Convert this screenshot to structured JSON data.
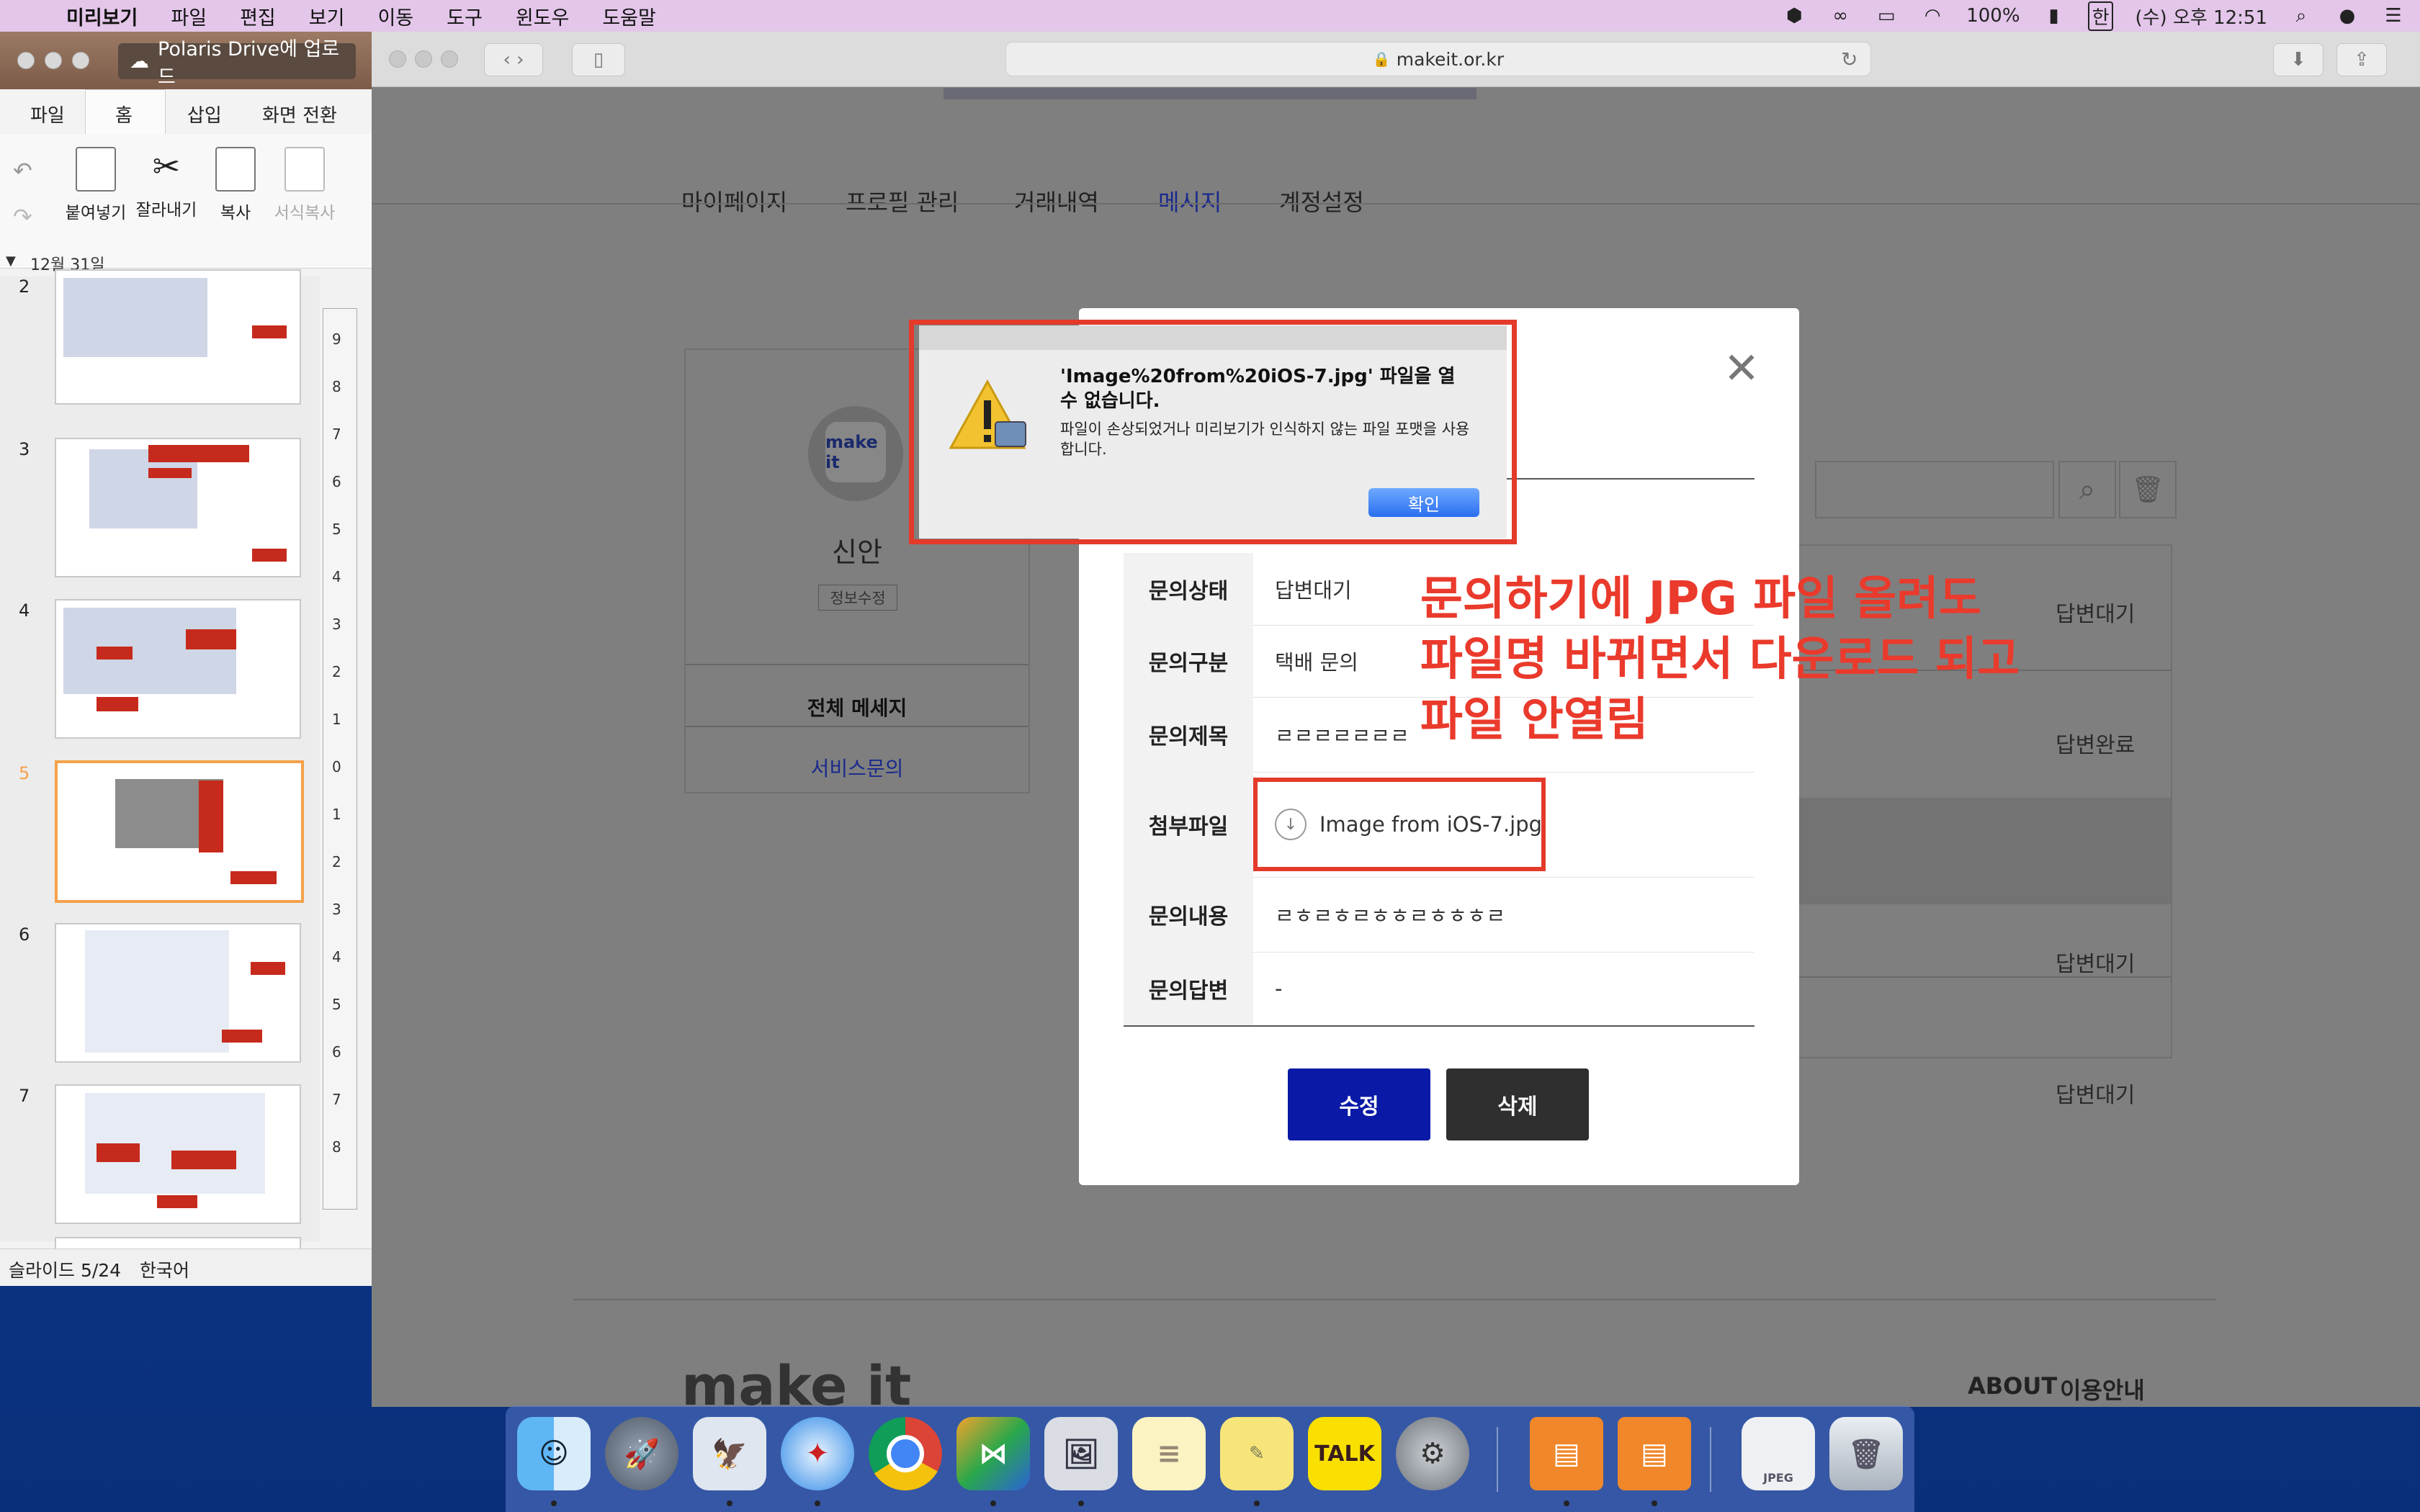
{
  "menubar": {
    "app_name": "미리보기",
    "items": [
      "파일",
      "편집",
      "보기",
      "이동",
      "도구",
      "윈도우",
      "도움말"
    ],
    "battery": "100%",
    "input_lang": "한",
    "clock": "(수) 오후 12:51"
  },
  "browser": {
    "url": "makeit.or.kr",
    "nav": [
      "마이페이지",
      "프로필 관리",
      "거래내역",
      "메시지",
      "계정설정"
    ],
    "active_nav": "메시지",
    "profile_name": "신안",
    "profile_edit": "정보수정",
    "logo_text": "make it",
    "menu_all_messages": "전체 메세지",
    "menu_service": "서비스문의",
    "statuses": [
      "답변대기",
      "답변완료",
      "답변대기",
      "답변대기"
    ],
    "footer_logo": "make it",
    "footer_about": "ABOUT",
    "footer_guide": "이용안내"
  },
  "modal": {
    "rows": [
      {
        "label": "문의상태",
        "value": "답변대기"
      },
      {
        "label": "문의구분",
        "value": "택배 문의"
      },
      {
        "label": "문의제목",
        "value": "ㄹㄹㄹㄹㄹㄹㄹ"
      },
      {
        "label": "첨부파일",
        "value": "Image from iOS-7.jpg"
      },
      {
        "label": "문의내용",
        "value": "ㄹㅎㄹㅎㄹㅎㅎㄹㅎㅎㅎㄹ"
      },
      {
        "label": "문의답변",
        "value": "-"
      }
    ],
    "edit_label": "수정",
    "delete_label": "삭제",
    "close_symbol": "✕"
  },
  "alert": {
    "title": "'Image%20from%20iOS-7.jpg' 파일을 열 수 없습니다.",
    "message": "파일이 손상되었거나 미리보기가 인식하지 않는 파일 포맷을 사용합니다.",
    "ok_label": "확인"
  },
  "annotation": {
    "lines": [
      "문의하기에 JPG 파일 올려도",
      "파일명 바뀌면서 다운로드 되고",
      "파일 안열림"
    ]
  },
  "polaris": {
    "upload_label": "Polaris Drive에 업로드",
    "tabs": [
      "파일",
      "홈",
      "삽입",
      "화면 전환"
    ],
    "active_tab": "홈",
    "tools": [
      "붙여넣기",
      "잘라내기",
      "복사",
      "서식복사"
    ],
    "date_group": "12월 31일",
    "slide_numbers": [
      "2",
      "3",
      "4",
      "5",
      "6",
      "7"
    ],
    "active_slide": "5",
    "ruler": [
      "9",
      "8",
      "7",
      "6",
      "5",
      "4",
      "3",
      "2",
      "1",
      "0",
      "1",
      "2",
      "3",
      "4",
      "5",
      "6",
      "7",
      "8"
    ],
    "status_slide": "슬라이드 5/24",
    "status_lang": "한국어"
  },
  "dock": {
    "talk_label": "TALK",
    "jpeg_label": "JPEG"
  },
  "colors": {
    "accent_red": "#e33a2a",
    "edit_blue": "#0a1aa6",
    "menubar": "#e3c6e9"
  }
}
